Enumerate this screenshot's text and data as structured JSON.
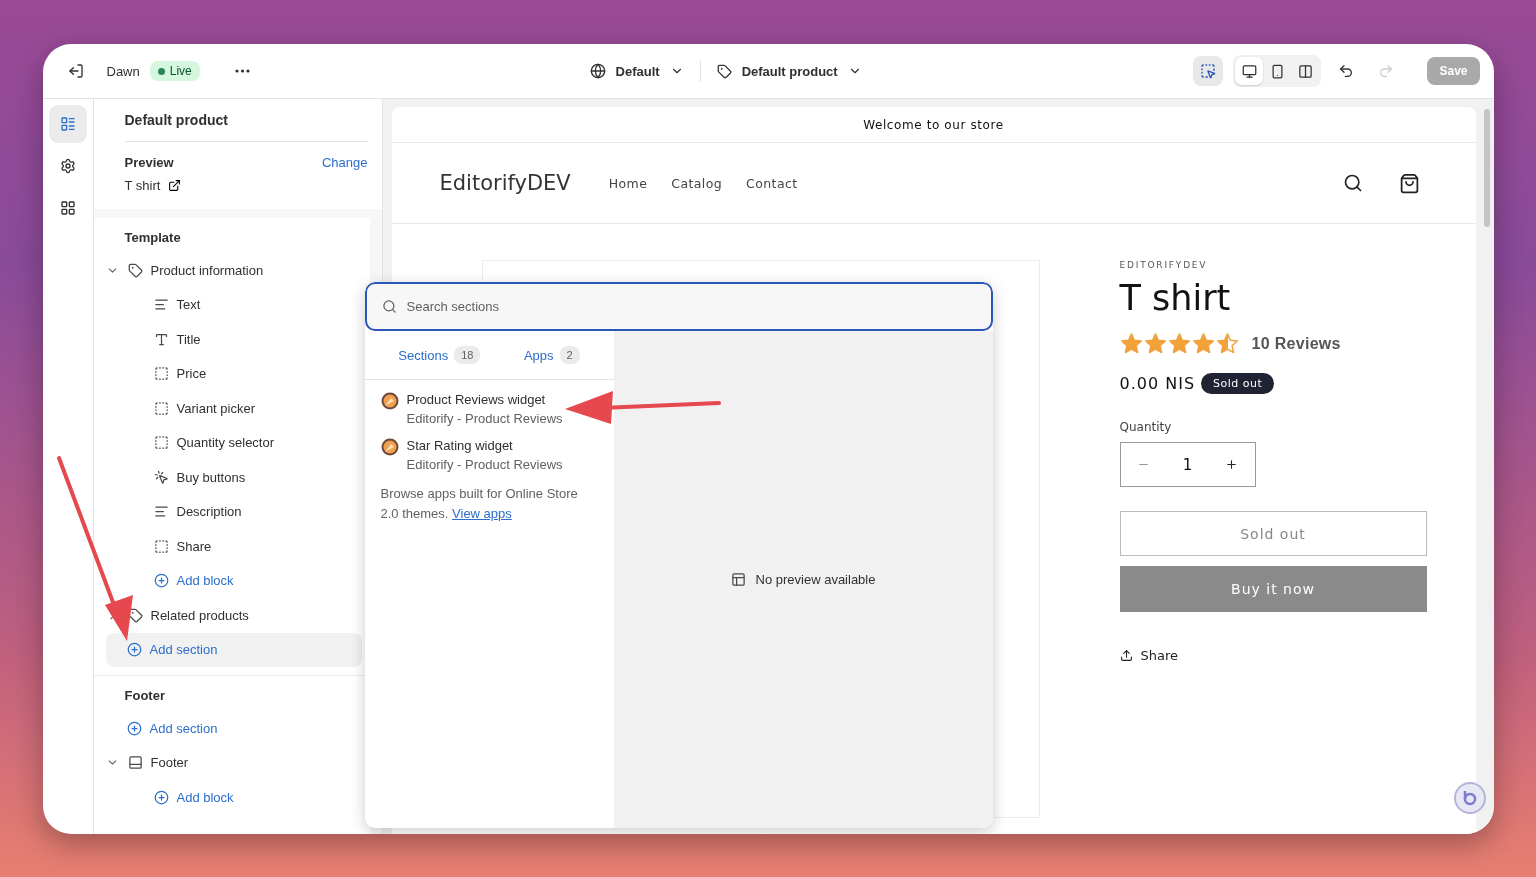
{
  "topbar": {
    "theme_name": "Dawn",
    "status": "Live",
    "template": "Default",
    "page": "Default product",
    "inspector_on": true,
    "redo_disabled": true,
    "save": "Save",
    "save_disabled": true,
    "view_modes": [
      {
        "kind": "desktop",
        "selected": true
      },
      {
        "kind": "mobile",
        "selected": false
      },
      {
        "kind": "fullwidth",
        "selected": false
      }
    ]
  },
  "rail": [
    {
      "kind": "sections",
      "selected": true
    },
    {
      "kind": "settings",
      "selected": false
    },
    {
      "kind": "apps",
      "selected": false
    }
  ],
  "sidebar": {
    "title": "Default product",
    "preview_label": "Preview",
    "preview_value": "T shirt",
    "change_link": "Change",
    "groups": [
      {
        "title": "Template",
        "items": [
          {
            "kind": "product_section",
            "label": "Product information",
            "expanded": true,
            "children": [
              {
                "kind": "text_block",
                "label": "Text"
              },
              {
                "kind": "title_block",
                "label": "Title"
              },
              {
                "kind": "generic_block",
                "label": "Price"
              },
              {
                "kind": "generic_block",
                "label": "Variant picker"
              },
              {
                "kind": "generic_block",
                "label": "Quantity selector"
              },
              {
                "kind": "buttons_block",
                "label": "Buy buttons"
              },
              {
                "kind": "text_block",
                "label": "Description"
              },
              {
                "kind": "generic_block",
                "label": "Share"
              },
              {
                "kind": "add",
                "label": "Add block"
              }
            ]
          },
          {
            "kind": "product_section",
            "label": "Related products",
            "expanded": false
          },
          {
            "kind": "add",
            "label": "Add section",
            "highlighted": true
          }
        ]
      },
      {
        "title": "Footer",
        "items": [
          {
            "kind": "add",
            "label": "Add section",
            "highlighted": false
          },
          {
            "kind": "footer_section",
            "label": "Footer",
            "expanded": true,
            "children": [
              {
                "kind": "add",
                "label": "Add block"
              }
            ]
          }
        ]
      }
    ]
  },
  "picker": {
    "search_placeholder": "Search sections",
    "tabs": [
      {
        "label": "Sections",
        "count": "18"
      },
      {
        "label": "Apps",
        "count": "2"
      }
    ],
    "apps": [
      {
        "name": "Product Reviews widget",
        "vendor": "Editorify - Product Reviews"
      },
      {
        "name": "Star Rating widget",
        "vendor": "Editorify - Product Reviews"
      }
    ],
    "browse_text": "Browse apps built for Online Store 2.0 themes.",
    "browse_link": "View apps",
    "preview_text": "No preview available"
  },
  "store": {
    "announcement": "Welcome to our store",
    "logo": "EditorifyDEV",
    "nav": [
      "Home",
      "Catalog",
      "Contact"
    ],
    "product": {
      "vendor": "EDITORIFYDEV",
      "title": "T shirt",
      "stars": 4.5,
      "reviews": "10 Reviews",
      "price": "0.00 NIS",
      "badge": "Sold out",
      "quantity_label": "Quantity",
      "quantity": "1",
      "sold_out_button": "Sold out",
      "buy_now": "Buy it now",
      "share": "Share"
    }
  }
}
